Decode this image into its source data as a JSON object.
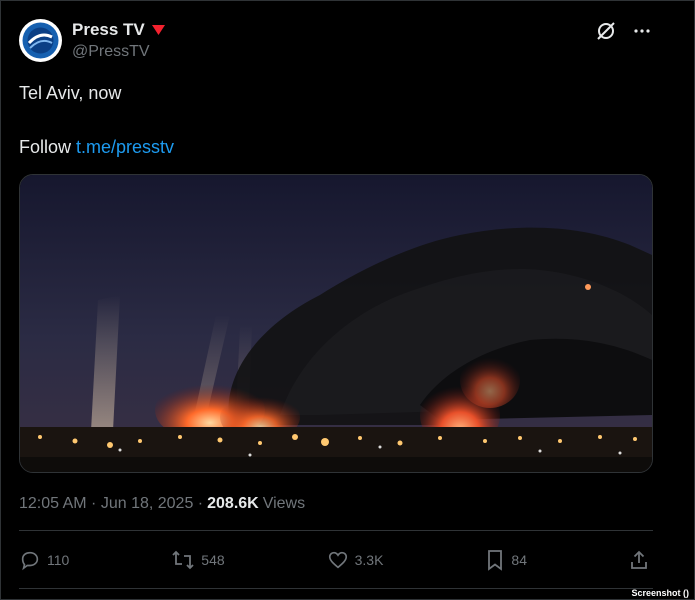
{
  "post": {
    "author_name": "Press TV",
    "author_handle": "@PressTV",
    "text_line1": "Tel Aviv, now",
    "follow_prefix": "Follow ",
    "follow_link": "t.me/presstv",
    "time": "12:05 AM · Jun 18, 2025 ·",
    "views_count": "208.6K",
    "views_label": "Views"
  },
  "actions": {
    "replies": "110",
    "reposts": "548",
    "likes": "3.3K",
    "bookmarks": "84"
  },
  "watermark": "Screenshot ()",
  "icons": {
    "avatar": "press-tv-logo",
    "badge": "red-triangle-icon",
    "grok": "grok-icon",
    "more": "more-icon",
    "reply": "reply-icon",
    "repost": "repost-icon",
    "like": "heart-icon",
    "bookmark": "bookmark-icon",
    "share": "share-icon"
  },
  "colors": {
    "link": "#1d9bf0",
    "badge": "#f4212e",
    "muted": "#71767b"
  }
}
